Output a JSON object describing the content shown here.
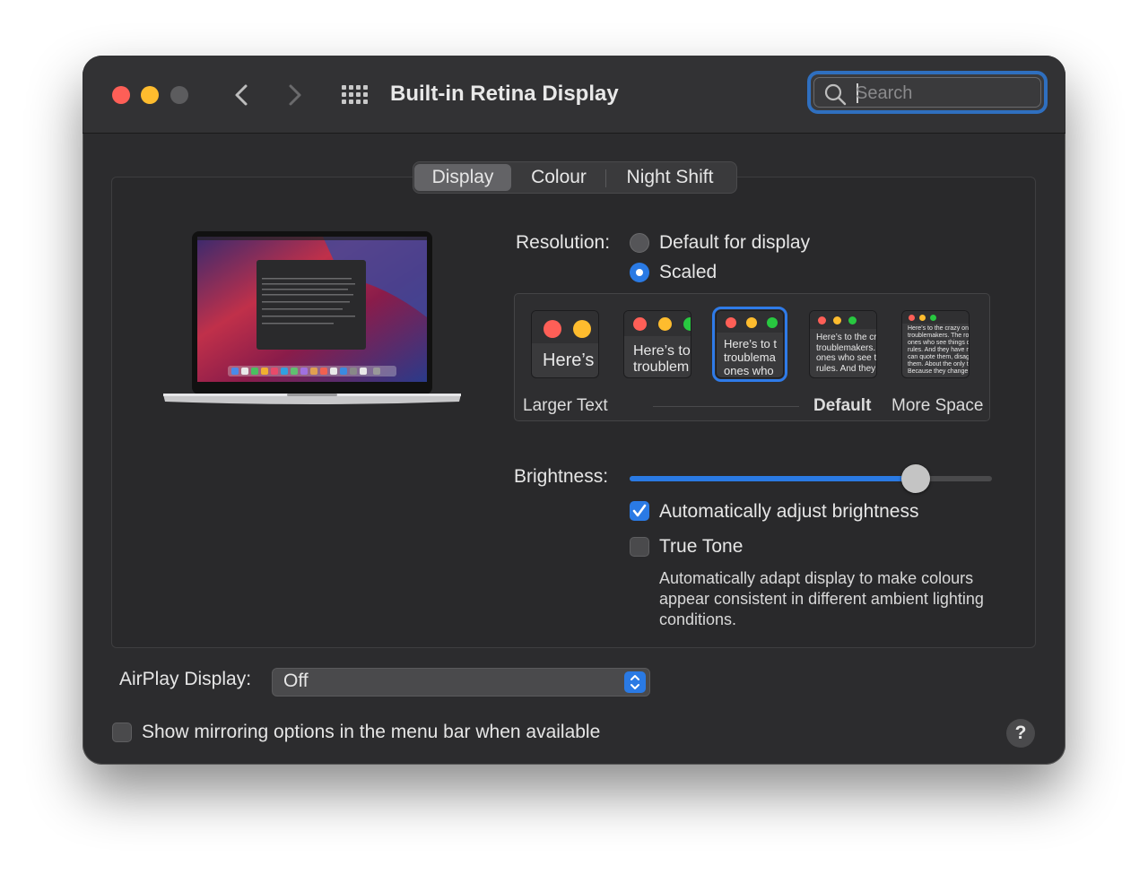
{
  "window": {
    "title": "Built-in Retina Display"
  },
  "search": {
    "placeholder": "Search",
    "value": ""
  },
  "tabs": [
    {
      "label": "Display",
      "active": true
    },
    {
      "label": "Colour",
      "active": false
    },
    {
      "label": "Night Shift",
      "active": false
    }
  ],
  "resolution": {
    "label": "Resolution:",
    "options": [
      {
        "label": "Default for display",
        "selected": false
      },
      {
        "label": "Scaled",
        "selected": true
      }
    ],
    "scale_options": [
      {
        "preview": "Here’s",
        "selected": false
      },
      {
        "preview": "Here’s to\ntroublem",
        "selected": false
      },
      {
        "preview": "Here’s to t\ntroublema\nones who",
        "selected": true
      },
      {
        "preview": "Here’s to the cr\ntroublemakers.\nones who see t\nrules. And they",
        "selected": false
      },
      {
        "preview": "Here’s to the crazy one\ntroublemakers. The rou\nones who see things dif\nrules. And they have no\ncan quote them, disagr\nthem. About the only th\nBecause they change t",
        "selected": false
      }
    ],
    "scale_labels": {
      "left": "Larger Text",
      "default": "Default",
      "right": "More Space"
    }
  },
  "brightness": {
    "label": "Brightness:",
    "level": 0.79
  },
  "auto_brightness": {
    "label": "Automatically adjust brightness",
    "checked": true
  },
  "true_tone": {
    "label": "True Tone",
    "checked": false,
    "description": "Automatically adapt display to make colours appear consistent in different ambient lighting conditions."
  },
  "airplay": {
    "label": "AirPlay Display:",
    "value": "Off"
  },
  "mirroring": {
    "label": "Show mirroring options in the menu bar when available",
    "checked": false
  },
  "help": {
    "label": "?"
  },
  "colors": {
    "accent": "#2a7ae4",
    "close": "#fe5f57",
    "minimize": "#febc2e",
    "zoom_disabled": "#5c5c5e",
    "window_bg": "#2c2c2e"
  },
  "icons": [
    "back-icon",
    "forward-icon",
    "grid-icon",
    "search-icon",
    "checkmark-icon",
    "chevron-updown-icon",
    "help-icon",
    "laptop-image"
  ]
}
